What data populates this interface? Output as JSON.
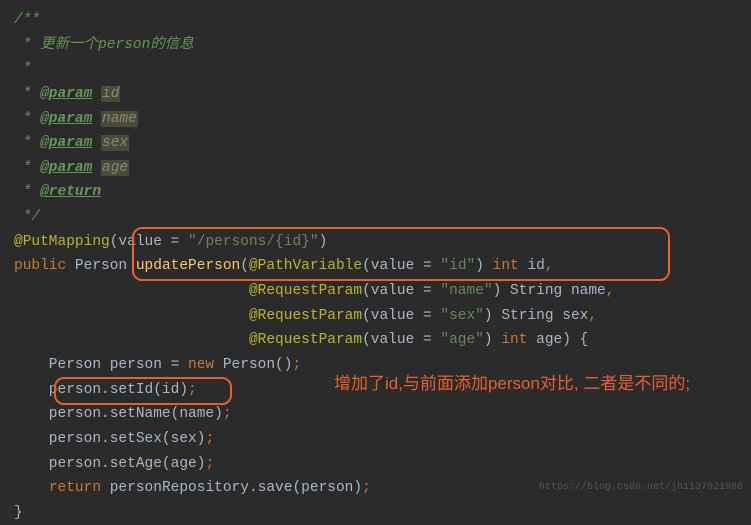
{
  "doc": {
    "open": "/**",
    "line1": " * 更新一个person的信息",
    "blank": " *",
    "param_tag": "@param",
    "return_tag": "@return",
    "p1": "id",
    "p2": "name",
    "p3": "sex",
    "p4": "age",
    "close": " */"
  },
  "code": {
    "put_anno": "@PutMapping",
    "put_open": "(value = ",
    "put_val": "\"/persons/{id}\"",
    "put_close": ")",
    "public": "public",
    "Person": " Person ",
    "method": "updatePerson",
    "path_var": "@PathVariable",
    "req_param": "@RequestParam",
    "val_eq": "(value = ",
    "id_str": "\"id\"",
    "name_str": "\"name\"",
    "sex_str": "\"sex\"",
    "age_str": "\"age\"",
    "int": "int",
    "String": "String",
    "id": " id",
    "name": " name",
    "sex": " sex",
    "age": " age",
    "new": "new",
    "l_person_decl": "    Person person = ",
    "l_person_ctor": " Person()",
    "semi": ";",
    "l_setid": "    person.setId(id)",
    "l_setname": "    person.setName(name)",
    "l_setsex": "    person.setSex(sex)",
    "l_setage": "    person.setAge(age)",
    "return": "return",
    "l_return_pre": "    ",
    "l_return_post": " personRepository.save(person)",
    "brace": "}"
  },
  "annotation_text": "增加了id,与前面添加person对比,\n二者是不同的;",
  "watermark": "https://blog.csdn.net/jh1137921986"
}
